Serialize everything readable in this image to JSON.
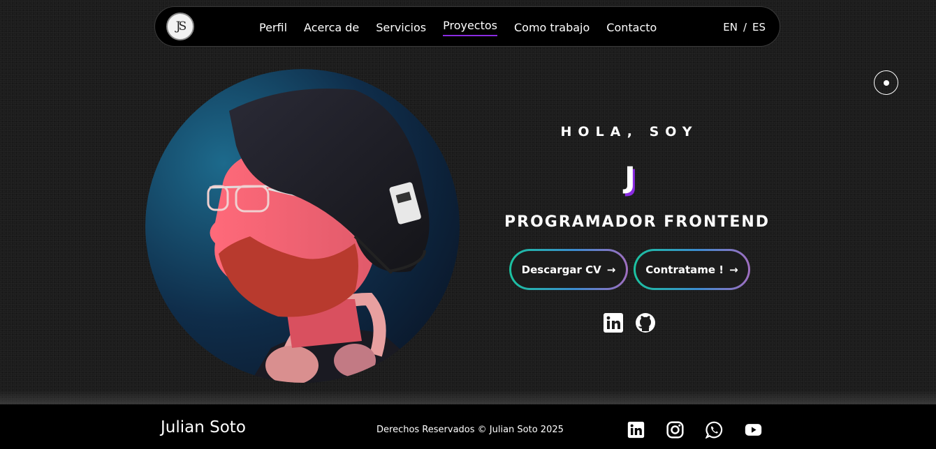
{
  "nav": {
    "logo_text": "JS",
    "links": [
      "Perfil",
      "Acerca de",
      "Servicios",
      "Proyectos",
      "Como trabajo",
      "Contacto"
    ],
    "active": "Proyectos",
    "lang_en": "EN",
    "lang_sep": "/",
    "lang_es": "ES"
  },
  "hero": {
    "greeting": "HOLA, SOY",
    "typed_initial": "J",
    "role": "PROGRAMADOR FRONTEND",
    "btn_cv": "Descargar CV",
    "btn_hire": "Contratame !",
    "arrow": "→",
    "socials": [
      "linkedin-icon",
      "github-icon"
    ]
  },
  "footer": {
    "name": "Julian Soto",
    "copyright": "Derechos Reservados © Julian Soto 2025",
    "socials": [
      "linkedin-icon",
      "instagram-icon",
      "whatsapp-icon",
      "youtube-icon"
    ]
  },
  "colors": {
    "accent": "#8a2be2",
    "background": "#1c1c1c",
    "gradient_start": "#1bc2a0",
    "gradient_end": "#a06ec0"
  }
}
